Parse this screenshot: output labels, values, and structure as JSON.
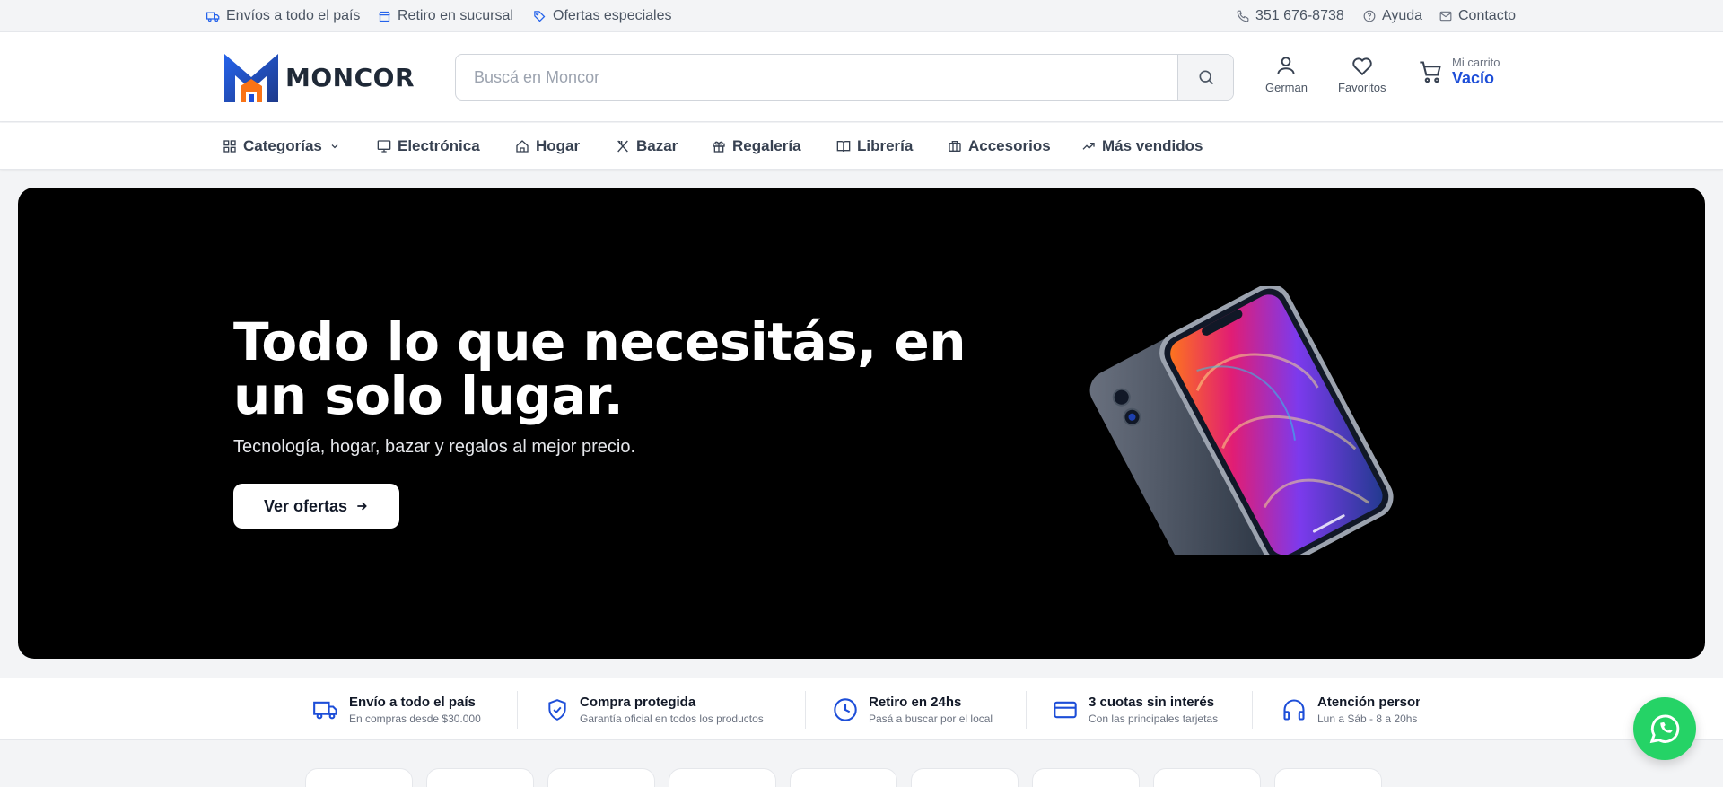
{
  "topbar": {
    "shipping": "Envíos a todo el país",
    "pickup": "Retiro en sucursal",
    "offers": "Ofertas especiales",
    "phone": "351 676-8738",
    "help": "Ayuda",
    "contact": "Contacto"
  },
  "header": {
    "logo_text": "MONCOR",
    "search_placeholder": "Buscá en Moncor",
    "user_label": "German",
    "favorites_label": "Favoritos",
    "cart_small": "Mi carrito",
    "cart_status": "Vacío"
  },
  "nav": {
    "items": [
      {
        "label": "Categorías",
        "icon": "grid-icon"
      },
      {
        "label": "Electrónica",
        "icon": "monitor-icon"
      },
      {
        "label": "Hogar",
        "icon": "home-icon"
      },
      {
        "label": "Bazar",
        "icon": "utensils-icon"
      },
      {
        "label": "Regalería",
        "icon": "gift-icon"
      },
      {
        "label": "Librería",
        "icon": "book-icon"
      },
      {
        "label": "Accesorios",
        "icon": "briefcase-icon"
      },
      {
        "label": "Más vendidos",
        "icon": "trending-up-icon"
      }
    ]
  },
  "hero": {
    "title": "Todo lo que necesitás, en un solo lugar.",
    "subtitle": "Tecnología, hogar, bazar y regalos al mejor precio.",
    "cta": "Ver ofertas"
  },
  "features": [
    {
      "title": "Envío a todo el país",
      "subtitle": "En compras desde $30.000",
      "icon": "truck-icon"
    },
    {
      "title": "Compra protegida",
      "subtitle": "Garantía oficial en todos los productos",
      "icon": "shield-check-icon"
    },
    {
      "title": "Retiro en 24hs",
      "subtitle": "Pasá a buscar por el local",
      "icon": "clock-icon"
    },
    {
      "title": "3 cuotas sin interés",
      "subtitle": "Con las principales tarjetas",
      "icon": "credit-card-icon"
    },
    {
      "title": "Atención personalizada",
      "subtitle": "Lun a Sáb - 8 a 20hs",
      "icon": "headphones-icon"
    }
  ],
  "colors": {
    "accent": "#1d4ed8",
    "hero_bg": "#000000",
    "whatsapp": "#25d366"
  }
}
